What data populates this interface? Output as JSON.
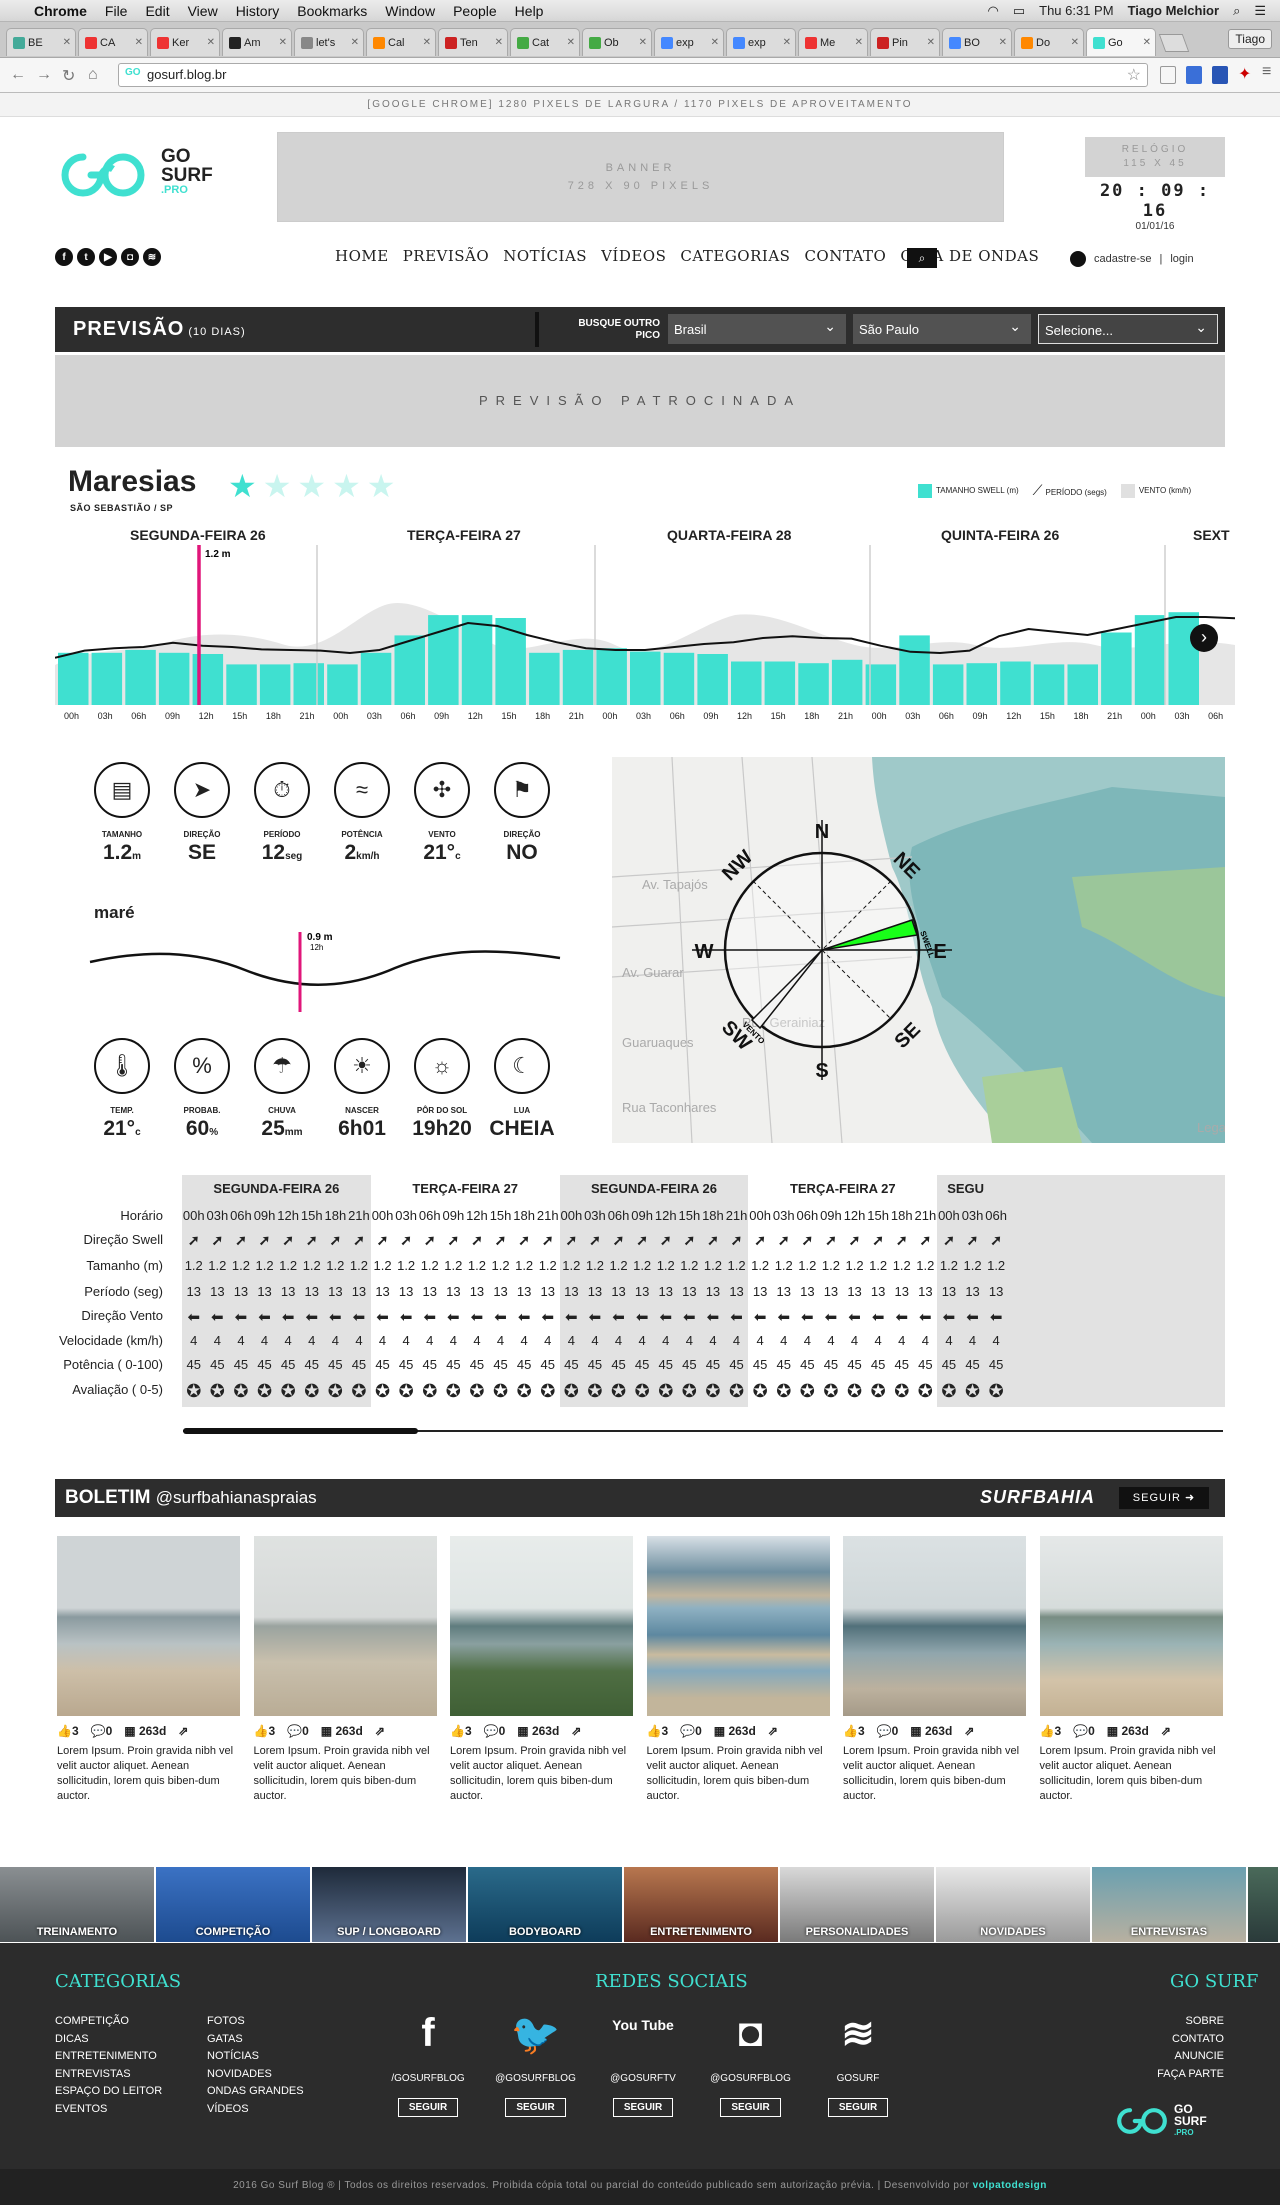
{
  "os": {
    "apple": "",
    "app": "Chrome",
    "menus": [
      "File",
      "Edit",
      "View",
      "History",
      "Bookmarks",
      "Window",
      "People",
      "Help"
    ],
    "clock": "Thu 6:31 PM",
    "user": "Tiago Melchior"
  },
  "browser": {
    "tabs": [
      "BE",
      "CA",
      "Ker",
      "Am",
      "let's",
      "Cal",
      "Ten",
      "Cat",
      "Ob",
      "exp",
      "exp",
      "Me",
      "Pin",
      "BO",
      "Do",
      "Go"
    ],
    "profile": "Tiago",
    "url": "gosurf.blog.br"
  },
  "page": {
    "info_line": "[GOOGLE CHROME] 1280 PIXELS DE LARGURA / 1170 PIXELS DE APROVEITAMENTO",
    "logo": {
      "line1": "GO",
      "line2": "SURF",
      "line3": ".PRO"
    },
    "banner": {
      "line1": "BANNER",
      "line2": "728 X 90 PIXELS"
    },
    "clock": {
      "label1": "RELÓGIO",
      "label2": "115 X 45",
      "time": "20 : 09 : 16",
      "date": "01/01/16"
    },
    "nav": [
      "HOME",
      "PREVISÃO",
      "NOTÍCIAS",
      "VÍDEOS",
      "CATEGORIAS",
      "CONTATO",
      "GUIA DE ONDAS"
    ],
    "login": {
      "register": "cadastre-se",
      "sep": "|",
      "login": "login"
    },
    "forecast_bar": {
      "title": "PREVISÃO",
      "subtitle": "(10 DIAS)",
      "busque": "BUSQUE OUTRO PICO",
      "country": "Brasil",
      "state": "São Paulo",
      "spot": "Selecione..."
    },
    "sponsored": "PREVISÃO PATROCINADA",
    "spot": {
      "name": "Maresias",
      "location": "SÃO SEBASTIÃO / SP",
      "rating": 1,
      "legend": [
        "TAMANHO SWELL (m)",
        "PERÍODO (segs)",
        "VENTO (km/h)"
      ],
      "days": [
        "SEGUNDA-FEIRA 26",
        "TERÇA-FEIRA 27",
        "QUARTA-FEIRA 28",
        "QUINTA-FEIRA 26",
        "SEXT"
      ],
      "marker": "1.2 m"
    },
    "stats_top": [
      {
        "label": "TAMANHO",
        "value": "1.2",
        "unit": "m",
        "icon": "ruler-icon"
      },
      {
        "label": "DIREÇÃO",
        "value": "SE",
        "unit": "",
        "icon": "arrow-icon"
      },
      {
        "label": "PERÍODO",
        "value": "12",
        "unit": "seg",
        "icon": "stopwatch-icon"
      },
      {
        "label": "POTÊNCIA",
        "value": "2",
        "unit": "km/h",
        "icon": "wave-icon"
      },
      {
        "label": "VENTO",
        "value": "21°",
        "unit": "c",
        "icon": "pinwheel-icon"
      },
      {
        "label": "DIREÇÃO",
        "value": "NO",
        "unit": "",
        "icon": "windsock-icon"
      }
    ],
    "mare": {
      "title": "maré",
      "marker": "0.9 m",
      "time": "12h"
    },
    "stats_bottom": [
      {
        "label": "TEMP.",
        "value": "21°",
        "unit": "c",
        "icon": "thermometer-icon"
      },
      {
        "label": "PROBAB.",
        "value": "60",
        "unit": "%",
        "icon": "percent-icon"
      },
      {
        "label": "CHUVA",
        "value": "25",
        "unit": "mm",
        "icon": "rain-icon"
      },
      {
        "label": "NASCER",
        "value": "6h01",
        "unit": "",
        "icon": "sunrise-icon"
      },
      {
        "label": "PÔR DO SOL",
        "value": "19h20",
        "unit": "",
        "icon": "sunset-icon"
      },
      {
        "label": "LUA",
        "value": "CHEIA",
        "unit": "",
        "icon": "moon-icon"
      }
    ],
    "compass": {
      "n": "N",
      "ne": "NE",
      "e": "E",
      "se": "SE",
      "s": "S",
      "sw": "SW",
      "w": "W",
      "nw": "NW",
      "swell": "SWELL",
      "vento": "VENTO",
      "map_text": [
        "Av. Tapajós",
        "Av. Guarar",
        "Guaruaques",
        "Rua Taconhares",
        "Rua Gerainiaz",
        "Legal"
      ]
    },
    "table": {
      "days": [
        "SEGUNDA-FEIRA 26",
        "TERÇA-FEIRA 27",
        "SEGUNDA-FEIRA 26",
        "TERÇA-FEIRA 27",
        "SEGU"
      ],
      "rows": [
        "Horário",
        "Direção Swell",
        "Tamanho (m)",
        "Período (seg)",
        "Direção Vento",
        "Velocidade (km/h)",
        "Potência ( 0-100)",
        "Avaliação ( 0-5)"
      ],
      "size": "1.2",
      "period": "13",
      "speed": "4",
      "power": "45",
      "rating": "0"
    },
    "boletim": {
      "title": "BOLETIM",
      "handle": "@surfbahianaspraias",
      "brand": "SURFBAHIA",
      "follow": "SEGUIR"
    },
    "posts": [
      {
        "likes": "3",
        "comments": "0",
        "age": "263d",
        "text": "Lorem Ipsum. Proin gravida nibh vel velit auctor aliquet. Aenean sollicitudin, lorem quis biben-dum auctor."
      },
      {
        "likes": "3",
        "comments": "0",
        "age": "263d",
        "text": "Lorem Ipsum. Proin gravida nibh vel velit auctor aliquet. Aenean sollicitudin, lorem quis biben-dum auctor."
      },
      {
        "likes": "3",
        "comments": "0",
        "age": "263d",
        "text": "Lorem Ipsum. Proin gravida nibh vel velit auctor aliquet. Aenean sollicitudin, lorem quis biben-dum auctor."
      },
      {
        "likes": "3",
        "comments": "0",
        "age": "263d",
        "text": "Lorem Ipsum. Proin gravida nibh vel velit auctor aliquet. Aenean sollicitudin, lorem quis biben-dum auctor."
      },
      {
        "likes": "3",
        "comments": "0",
        "age": "263d",
        "text": "Lorem Ipsum. Proin gravida nibh vel velit auctor aliquet. Aenean sollicitudin, lorem quis biben-dum auctor."
      },
      {
        "likes": "3",
        "comments": "0",
        "age": "263d",
        "text": "Lorem Ipsum. Proin gravida nibh vel velit auctor aliquet. Aenean sollicitudin, lorem quis biben-dum auctor."
      }
    ],
    "categories_strip": [
      "TREINAMENTO",
      "COMPETIÇÃO",
      "SUP / LONGBOARD",
      "BODYBOARD",
      "ENTRETENIMENTO",
      "PERSONALIDADES",
      "NOVIDADES",
      "ENTREVISTAS"
    ],
    "footer": {
      "cat_title": "CATEGORIAS",
      "col1": [
        "COMPETIÇÃO",
        "DICAS",
        "ENTRETENIMENTO",
        "ENTREVISTAS",
        "ESPAÇO DO LEITOR",
        "EVENTOS"
      ],
      "col2": [
        "FOTOS",
        "GATAS",
        "NOTÍCIAS",
        "NOVIDADES",
        "ONDAS GRANDES",
        "VÍDEOS"
      ],
      "social_title": "REDES SOCIAIS",
      "socials": [
        {
          "name": "/GOSURFBLOG",
          "icon": "facebook-icon",
          "glyph": "f"
        },
        {
          "name": "@GOSURFBLOG",
          "icon": "twitter-icon",
          "glyph": "🐦"
        },
        {
          "name": "@GOSURFTV",
          "icon": "youtube-icon",
          "glyph": "You Tube"
        },
        {
          "name": "@GOSURFBLOG",
          "icon": "instagram-icon",
          "glyph": "◘"
        },
        {
          "name": "GOSURF",
          "icon": "spotify-icon",
          "glyph": "≋"
        }
      ],
      "follow": "SEGUIR",
      "gosurf_title": "GO SURF",
      "links": [
        "SOBRE",
        "CONTATO",
        "ANUNCIE",
        "FAÇA PARTE"
      ],
      "copyright": "2016 Go Surf Blog ® | Todos os direitos reservados. Proibida cópia total ou parcial do conteúdo publicado sem autorização prévia. | Desenvolvido por",
      "dev": "volpatodesign"
    }
  },
  "colors": {
    "teal": "#3fe0d0",
    "dark": "#2d2d2d",
    "green": "#19ff19",
    "pink": "#e0167a"
  },
  "chart_data": {
    "type": "bar",
    "series": [
      {
        "name": "TAMANHO SWELL (m)",
        "values": [
          0.9,
          0.9,
          0.95,
          0.9,
          0.88,
          0.7,
          0.7,
          0.72,
          0.7,
          0.9,
          1.2,
          1.55,
          1.55,
          1.5,
          0.9,
          0.95,
          0.98,
          0.92,
          0.9,
          0.88,
          0.75,
          0.75,
          0.72,
          0.78,
          0.7,
          1.2,
          0.7,
          0.72,
          0.75,
          0.7,
          0.7,
          1.25,
          1.55,
          1.6
        ]
      },
      {
        "name": "PERÍODO (segs)",
        "values": [
          0.62,
          0.74,
          0.78,
          0.8,
          0.87,
          0.82,
          0.8,
          0.76,
          0.75,
          0.74,
          0.7,
          0.75,
          0.9,
          1.05,
          1.2,
          1.15,
          1.0,
          0.88,
          0.78,
          0.75,
          0.75,
          0.8,
          0.85,
          0.88,
          0.95,
          0.98,
          0.95,
          0.94,
          0.82,
          0.72,
          0.7,
          0.74,
          0.98,
          1.1,
          1.05,
          1.0,
          1.1,
          1.2,
          1.3,
          1.3,
          1.28
        ]
      }
    ],
    "x": [
      "00h",
      "03h",
      "06h",
      "09h",
      "12h",
      "15h",
      "18h",
      "21h",
      "00h",
      "03h",
      "06h",
      "09h",
      "12h",
      "15h",
      "18h",
      "21h",
      "00h",
      "03h",
      "06h",
      "09h",
      "12h",
      "15h",
      "18h",
      "21h",
      "00h",
      "03h",
      "06h",
      "09h",
      "12h",
      "15h",
      "18h",
      "21h",
      "00h",
      "03h",
      "06h"
    ],
    "marker_x": "12h"
  }
}
